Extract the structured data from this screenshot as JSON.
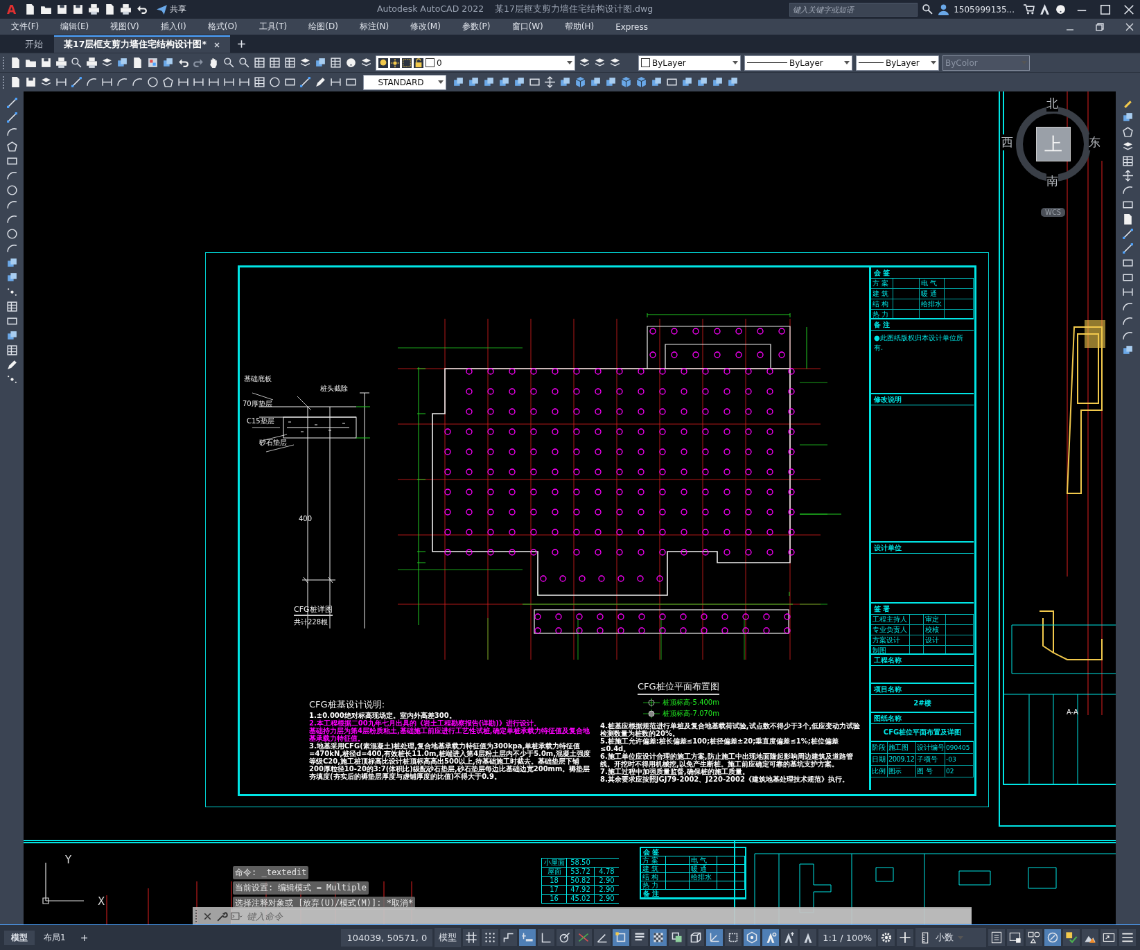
{
  "title_bar": {
    "logo": "A",
    "share": "共享",
    "app_title": "Autodesk AutoCAD 2022",
    "document_title": "某17层框支剪力墙住宅结构设计图.dwg",
    "search": {
      "placeholder": "键入关键字或短语"
    },
    "user": "1505999135..."
  },
  "menu": [
    "文件(F)",
    "编辑(E)",
    "视图(V)",
    "插入(I)",
    "格式(O)",
    "工具(T)",
    "绘图(D)",
    "标注(N)",
    "修改(M)",
    "参数(P)",
    "窗口(W)",
    "帮助(H)",
    "Express"
  ],
  "tabs": [
    {
      "label": "开始",
      "selected": false
    },
    {
      "label": "某17层框支剪力墙住宅结构设计图*",
      "selected": true
    }
  ],
  "toolbar": {
    "layer": "0",
    "color_setting": "ByLayer",
    "linetype": "ByLayer",
    "lineweight": "ByLayer",
    "plot_style": {
      "value": "ByColor",
      "disabled": true
    },
    "text_style": "STANDARD"
  },
  "viewcube": {
    "north": "北",
    "south": "南",
    "east": "东",
    "west": "西",
    "top": "上",
    "wcs": "WCS"
  },
  "drawing": {
    "detail": {
      "title": "CFG桩详图",
      "count": "共计228根",
      "labels": [
        "基础底板",
        "桩头截除",
        "70厚垫层",
        "C15垫层",
        "砂石垫层",
        "400"
      ]
    },
    "plan_title": "CFG桩位平面布置图",
    "legend": [
      "桩顶标高-5.400m",
      "桩顶标高-7.070m"
    ],
    "notes_title": "CFG桩基设计说明:",
    "notes": [
      {
        "text": "1.±0.000绝对标高现场定。室内外高差300。",
        "color": "#ffffff"
      },
      {
        "text": "2.本工程根据二00九年七月出具的《岩土工程勘察报告(详勘)》进行设计。",
        "color": "#ff00ff"
      },
      {
        "text": "基础持力层为第4层粉质粘土,基础施工前应进行工艺性试桩,确定单桩承载力特征值及复合地基承载力特征值。",
        "color": "#ff00ff"
      },
      {
        "text": "3.地基采用CFG(素混凝土)桩处理,复合地基承载力特征值为300kpa,单桩承载力特征值=470kN,桩径d=400,有效桩长11.0m,桩端进入第4层粉土层内不少于5.0m,混凝土强度等级C20,施工桩顶标高比设计桩顶标高高出500以上,待基础施工时截去。基础垫层下铺200厚粒径10-20的3:7(体积比)级配砂石垫层,砂石垫层每边比基础边宽200mm。褥垫层夯填度(夯实后的褥垫层厚度与虚铺厚度的比值)不得大于0.9。",
        "color": "#ffffff"
      }
    ],
    "notes_right": [
      {
        "text": "4.桩基应根据规范进行单桩及复合地基载荷试验,试点数不得少于3个,低应变动力试验检测数量为桩数的20%。",
        "color": "#ffffff"
      },
      {
        "text": "5.桩施工允许偏差:桩长偏差≤100;桩径偏差±20;垂直度偏差≤1%;桩位偏差≤0.4d。",
        "color": "#ffffff"
      },
      {
        "text": "6.施工单位应设计合理的施工方案,防止施工中出现地面隆起影响周边建筑及道路管线。开挖时不得用机械挖,以免产生断桩。施工前应确定可靠的基坑支护方案。",
        "color": "#ffffff"
      },
      {
        "text": "7.施工过程中加强质量监督,确保桩的施工质量。",
        "color": "#ffffff"
      },
      {
        "text": "8.其余要求应按照JGJ79-2002、J220-2002《建筑地基处理技术规范》执行。",
        "color": "#ffffff"
      }
    ],
    "title_block": {
      "sign_header": "会 签",
      "sign_rows": [
        [
          "方 案",
          "电 气"
        ],
        [
          "建 筑",
          "暖 通"
        ],
        [
          "结 构",
          "给排水"
        ],
        [
          "热 力"
        ]
      ],
      "remarks_header": "备 注",
      "remarks": "●此图纸版权归本设计单位所有.",
      "revision_header": "修改说明",
      "designer_header": "设计单位",
      "signature_header": "签 署",
      "signature_rows": [
        [
          "工程主持人",
          "审定"
        ],
        [
          "专业负责人",
          "校核"
        ],
        [
          "方案设计",
          "设计"
        ],
        [
          "制图"
        ]
      ],
      "project_header": "工程名称",
      "item_header": "项目名称",
      "item": "2#楼",
      "sheet_header": "图纸名称",
      "sheet": "CFG桩位平面布置及详图",
      "info_rows": [
        [
          "阶段",
          "施工图",
          "设计编号",
          "090405"
        ],
        [
          "日期",
          "2009.12",
          "子项号",
          "-03"
        ],
        [
          "比例",
          "图示",
          "图 号",
          "02"
        ]
      ]
    },
    "side_label": "A-A",
    "floor_table": [
      [
        "小屋面",
        "58.50"
      ],
      [
        "屋面",
        "53.72",
        "4.78"
      ],
      [
        "18",
        "50.82",
        "2.90"
      ],
      [
        "17",
        "47.92",
        "2.90"
      ],
      [
        "16",
        "45.02",
        "2.90"
      ]
    ],
    "mini_block": {
      "header": "会 签",
      "rows": [
        [
          "方 案",
          "电 气"
        ],
        [
          "建 筑",
          "暖 通"
        ],
        [
          "结 构",
          "给排水"
        ],
        [
          "热 力"
        ]
      ],
      "remarks_header": "备 注"
    }
  },
  "ucs": {
    "y": "Y",
    "x": "X"
  },
  "command_history": [
    "命令: _textedit",
    "当前设置: 编辑模式 = Multiple",
    "选择注释对象或 [放弃(U)/模式(M)]: *取消*"
  ],
  "command_input": {
    "placeholder": "键入命令"
  },
  "layout_tabs": [
    {
      "label": "模型",
      "selected": true
    },
    {
      "label": "布局1",
      "selected": false
    }
  ],
  "add_layout": "+",
  "status_bar": {
    "coordinates": "104039, 50571, 0",
    "space": "模型",
    "toggles": [
      {
        "kind": "grid",
        "on": false
      },
      {
        "kind": "snap",
        "on": false
      },
      {
        "kind": "infer",
        "on": false
      },
      {
        "kind": "dynamic_input",
        "on": true
      },
      {
        "kind": "ortho",
        "on": false
      },
      {
        "kind": "polar",
        "on": false
      },
      {
        "kind": "isodraft",
        "on": false
      },
      {
        "kind": "angle",
        "on": false
      },
      {
        "kind": "osnap",
        "on": true
      },
      {
        "kind": "lineweight",
        "on": false
      },
      {
        "kind": "transparency",
        "on": true
      },
      {
        "kind": "selection_cycling",
        "on": false
      },
      {
        "kind": "snap_3d",
        "on": false
      },
      {
        "kind": "dynamic_ucs",
        "on": true
      },
      {
        "kind": "selection_filter",
        "on": false
      },
      {
        "kind": "gizmo",
        "on": true
      },
      {
        "kind": "annotation_visibility",
        "on": true
      },
      {
        "kind": "auto_scale",
        "on": false
      },
      {
        "kind": "annotation_scale",
        "on": false
      }
    ],
    "scale": "1:1 / 100%",
    "units": "小数",
    "tail_toggles": [
      {
        "kind": "hardware_acceleration",
        "on": true
      }
    ]
  }
}
